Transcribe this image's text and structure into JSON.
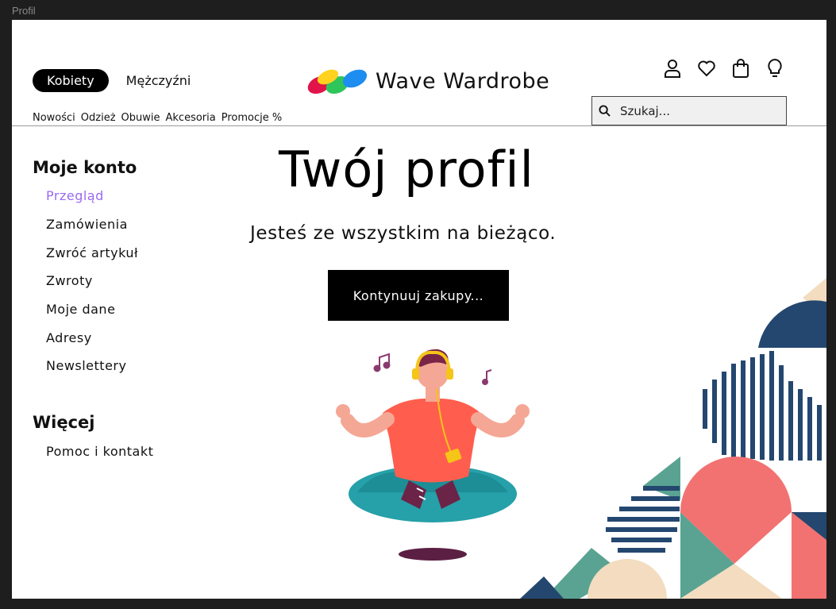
{
  "frame_label": "Profil",
  "header": {
    "gender_tabs": [
      "Kobiety",
      "Mężczyźni"
    ],
    "categories": [
      "Nowości",
      "Odzież",
      "Obuwie",
      "Akcesoria",
      "Promocje %"
    ],
    "brand": "Wave Wardrobe",
    "search_placeholder": "Szukaj...",
    "icons": [
      "user-icon",
      "heart-icon",
      "bag-icon",
      "lightbulb-icon"
    ]
  },
  "sidebar": {
    "account_heading": "Moje konto",
    "account_items": [
      "Przegląd",
      "Zamówienia",
      "Zwróć artykuł",
      "Zwroty",
      "Moje dane",
      "Adresy",
      "Newslettery"
    ],
    "active_item": "Przegląd",
    "more_heading": "Więcej",
    "more_items": [
      "Pomoc i kontakt"
    ]
  },
  "main": {
    "title": "Twój profil",
    "subtitle": "Jesteś ze wszystkim na bieżąco.",
    "cta_label": "Kontynuuj zakupy..."
  },
  "colors": {
    "accent_purple": "#9a6af0",
    "navy": "#24476f",
    "teal": "#5aa392",
    "coral": "#f27271",
    "sand": "#f3dcbf"
  }
}
